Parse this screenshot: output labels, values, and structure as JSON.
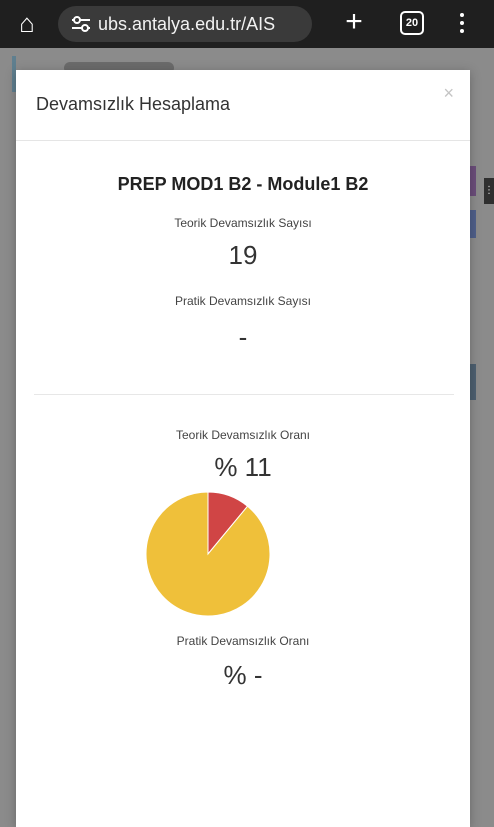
{
  "browser": {
    "url": "ubs.antalya.edu.tr/AIS",
    "tab_count": "20"
  },
  "modal": {
    "title": "Devamsızlık Hesaplama",
    "close": "×",
    "course_title": "PREP MOD1 B2 - Module1 B2",
    "theory_count_label": "Teorik Devamsızlık Sayısı",
    "theory_count_value": "19",
    "practice_count_label": "Pratik Devamsızlık Sayısı",
    "practice_count_value": "-",
    "theory_rate_label": "Teorik Devamsızlık Oranı",
    "theory_rate_value": "% 11",
    "practice_rate_label": "Pratik Devamsızlık Oranı",
    "practice_rate_value": "% -"
  },
  "chart_data": {
    "type": "pie",
    "values": [
      11,
      89
    ],
    "colors": [
      "#d04545",
      "#efc03a"
    ]
  }
}
